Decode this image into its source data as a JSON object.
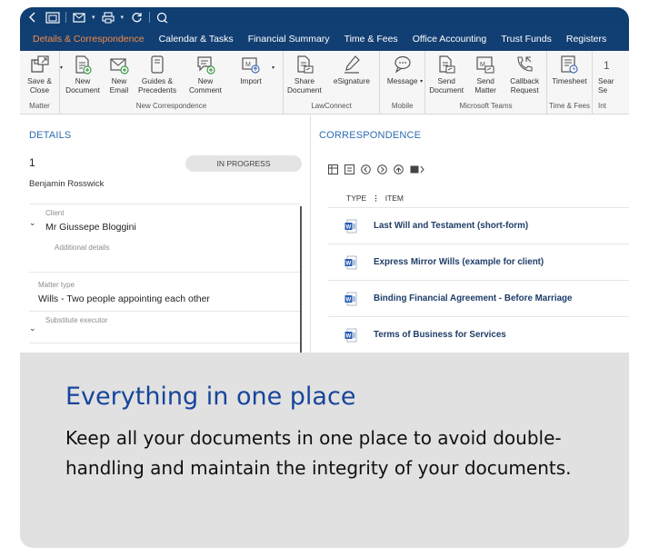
{
  "titlebar": {
    "icons": [
      "back-arrow-icon",
      "matter-folder-icon",
      "mail-icon",
      "print-icon",
      "refresh-icon",
      "tag-icon"
    ]
  },
  "tabs": [
    {
      "label": "Details & Correspondence",
      "active": true
    },
    {
      "label": "Calendar & Tasks"
    },
    {
      "label": "Financial Summary"
    },
    {
      "label": "Time & Fees"
    },
    {
      "label": "Office Accounting"
    },
    {
      "label": "Trust Funds"
    },
    {
      "label": "Registers"
    }
  ],
  "ribbon": {
    "groups": [
      {
        "label": "Matter",
        "buttons": [
          {
            "label": "Save &\nClose",
            "icon": "save-close-icon"
          }
        ]
      },
      {
        "label": "New Correspondence",
        "buttons": [
          {
            "label": "New\nDocument",
            "icon": "new-document-icon"
          },
          {
            "label": "New\nEmail",
            "icon": "new-email-icon"
          },
          {
            "label": "Guides &\nPrecedents",
            "icon": "guides-icon"
          },
          {
            "label": "New\nComment",
            "icon": "comment-icon"
          },
          {
            "label": "Import",
            "icon": "import-icon"
          }
        ]
      },
      {
        "label": "LawConnect",
        "buttons": [
          {
            "label": "Share\nDocument",
            "icon": "share-document-icon"
          },
          {
            "label": "eSignature",
            "icon": "esignature-icon"
          }
        ]
      },
      {
        "label": "Mobile",
        "buttons": [
          {
            "label": "Message",
            "icon": "message-icon"
          }
        ]
      },
      {
        "label": "Microsoft Teams",
        "buttons": [
          {
            "label": "Send\nDocument",
            "icon": "send-document-icon"
          },
          {
            "label": "Send\nMatter",
            "icon": "send-matter-icon"
          },
          {
            "label": "Callback\nRequest",
            "icon": "callback-icon"
          }
        ]
      },
      {
        "label": "Time & Fees",
        "buttons": [
          {
            "label": "Timesheet",
            "icon": "timesheet-icon"
          }
        ]
      },
      {
        "label": "Int",
        "buttons": [
          {
            "label": "Sear\nSe",
            "icon": "search-icon"
          }
        ]
      }
    ]
  },
  "details": {
    "title": "DETAILS",
    "matter_number": "1",
    "status": "IN PROGRESS",
    "person": "Benjamin Rosswick",
    "client_label": "Client",
    "client_value": "Mr Giussepe Bloggini",
    "additional": "Additional details",
    "matter_type_label": "Matter type",
    "matter_type_value": "Wills - Two people appointing each other",
    "substitute_label": "Substitute executor"
  },
  "correspondence": {
    "title": "CORRESPONDENCE",
    "columns": {
      "type": "TYPE",
      "sep": "⋮",
      "item": "ITEM"
    },
    "items": [
      {
        "name": "Last Will and Testament (short-form)",
        "type": "word"
      },
      {
        "name": "Express Mirror Wills (example for client)",
        "type": "word"
      },
      {
        "name": "Binding Financial Agreement - Before Marriage",
        "type": "word"
      },
      {
        "name": "Terms of Business for Services",
        "type": "word"
      }
    ]
  },
  "caption": {
    "title": "Everything in one place",
    "body": "Keep all your documents in one place to avoid double-handling and maintain the integrity of your documents."
  },
  "colors": {
    "titlebar": "#0f3e72",
    "active_tab": "#f48a44",
    "heading_blue": "#2c6cb0",
    "caption_title": "#16459b",
    "card_bg": "#e1e1e1"
  }
}
